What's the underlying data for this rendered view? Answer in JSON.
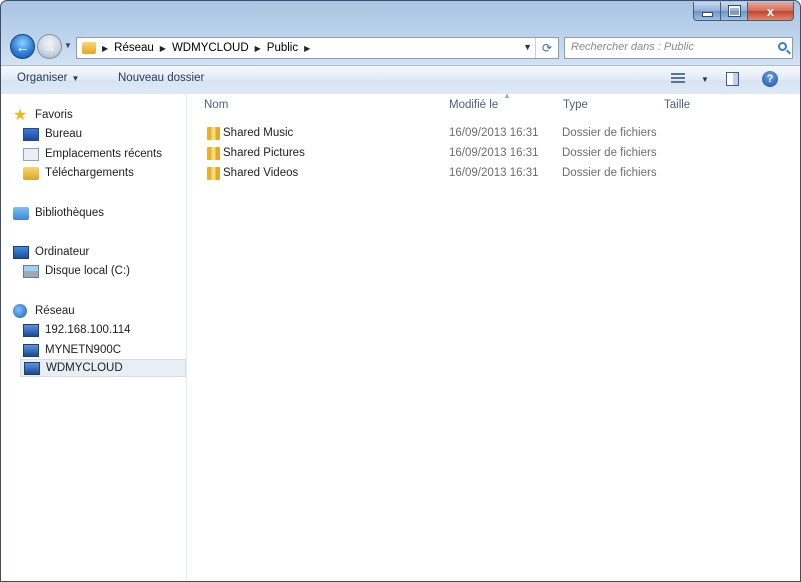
{
  "window": {
    "caption_buttons": {
      "minimize": "",
      "maximize": "",
      "close": "x"
    }
  },
  "nav": {
    "back_icon": "arrow-left-icon",
    "forward_icon": "arrow-right-icon",
    "breadcrumbs": [
      "Réseau",
      "WDMYCLOUD",
      "Public"
    ],
    "search_placeholder": "Rechercher dans : Public"
  },
  "toolbar": {
    "organize_label": "Organiser",
    "new_folder_label": "Nouveau dossier"
  },
  "sidebar": {
    "favorites_label": "Favoris",
    "desktop_label": "Bureau",
    "recent_label": "Emplacements récents",
    "downloads_label": "Téléchargements",
    "libraries_label": "Bibliothèques",
    "computer_label": "Ordinateur",
    "local_disk_label": "Disque local (C:)",
    "network_label": "Réseau",
    "network_items": [
      "192.168.100.114",
      "MYNETN900C",
      "WDMYCLOUD"
    ],
    "selected": "WDMYCLOUD"
  },
  "columns": {
    "name": "Nom",
    "modified": "Modifié le",
    "type": "Type",
    "size": "Taille"
  },
  "files": [
    {
      "name": "Shared Music",
      "modified": "16/09/2013 16:31",
      "type": "Dossier de fichiers"
    },
    {
      "name": "Shared Pictures",
      "modified": "16/09/2013 16:31",
      "type": "Dossier de fichiers"
    },
    {
      "name": "Shared Videos",
      "modified": "16/09/2013 16:31",
      "type": "Dossier de fichiers"
    }
  ]
}
